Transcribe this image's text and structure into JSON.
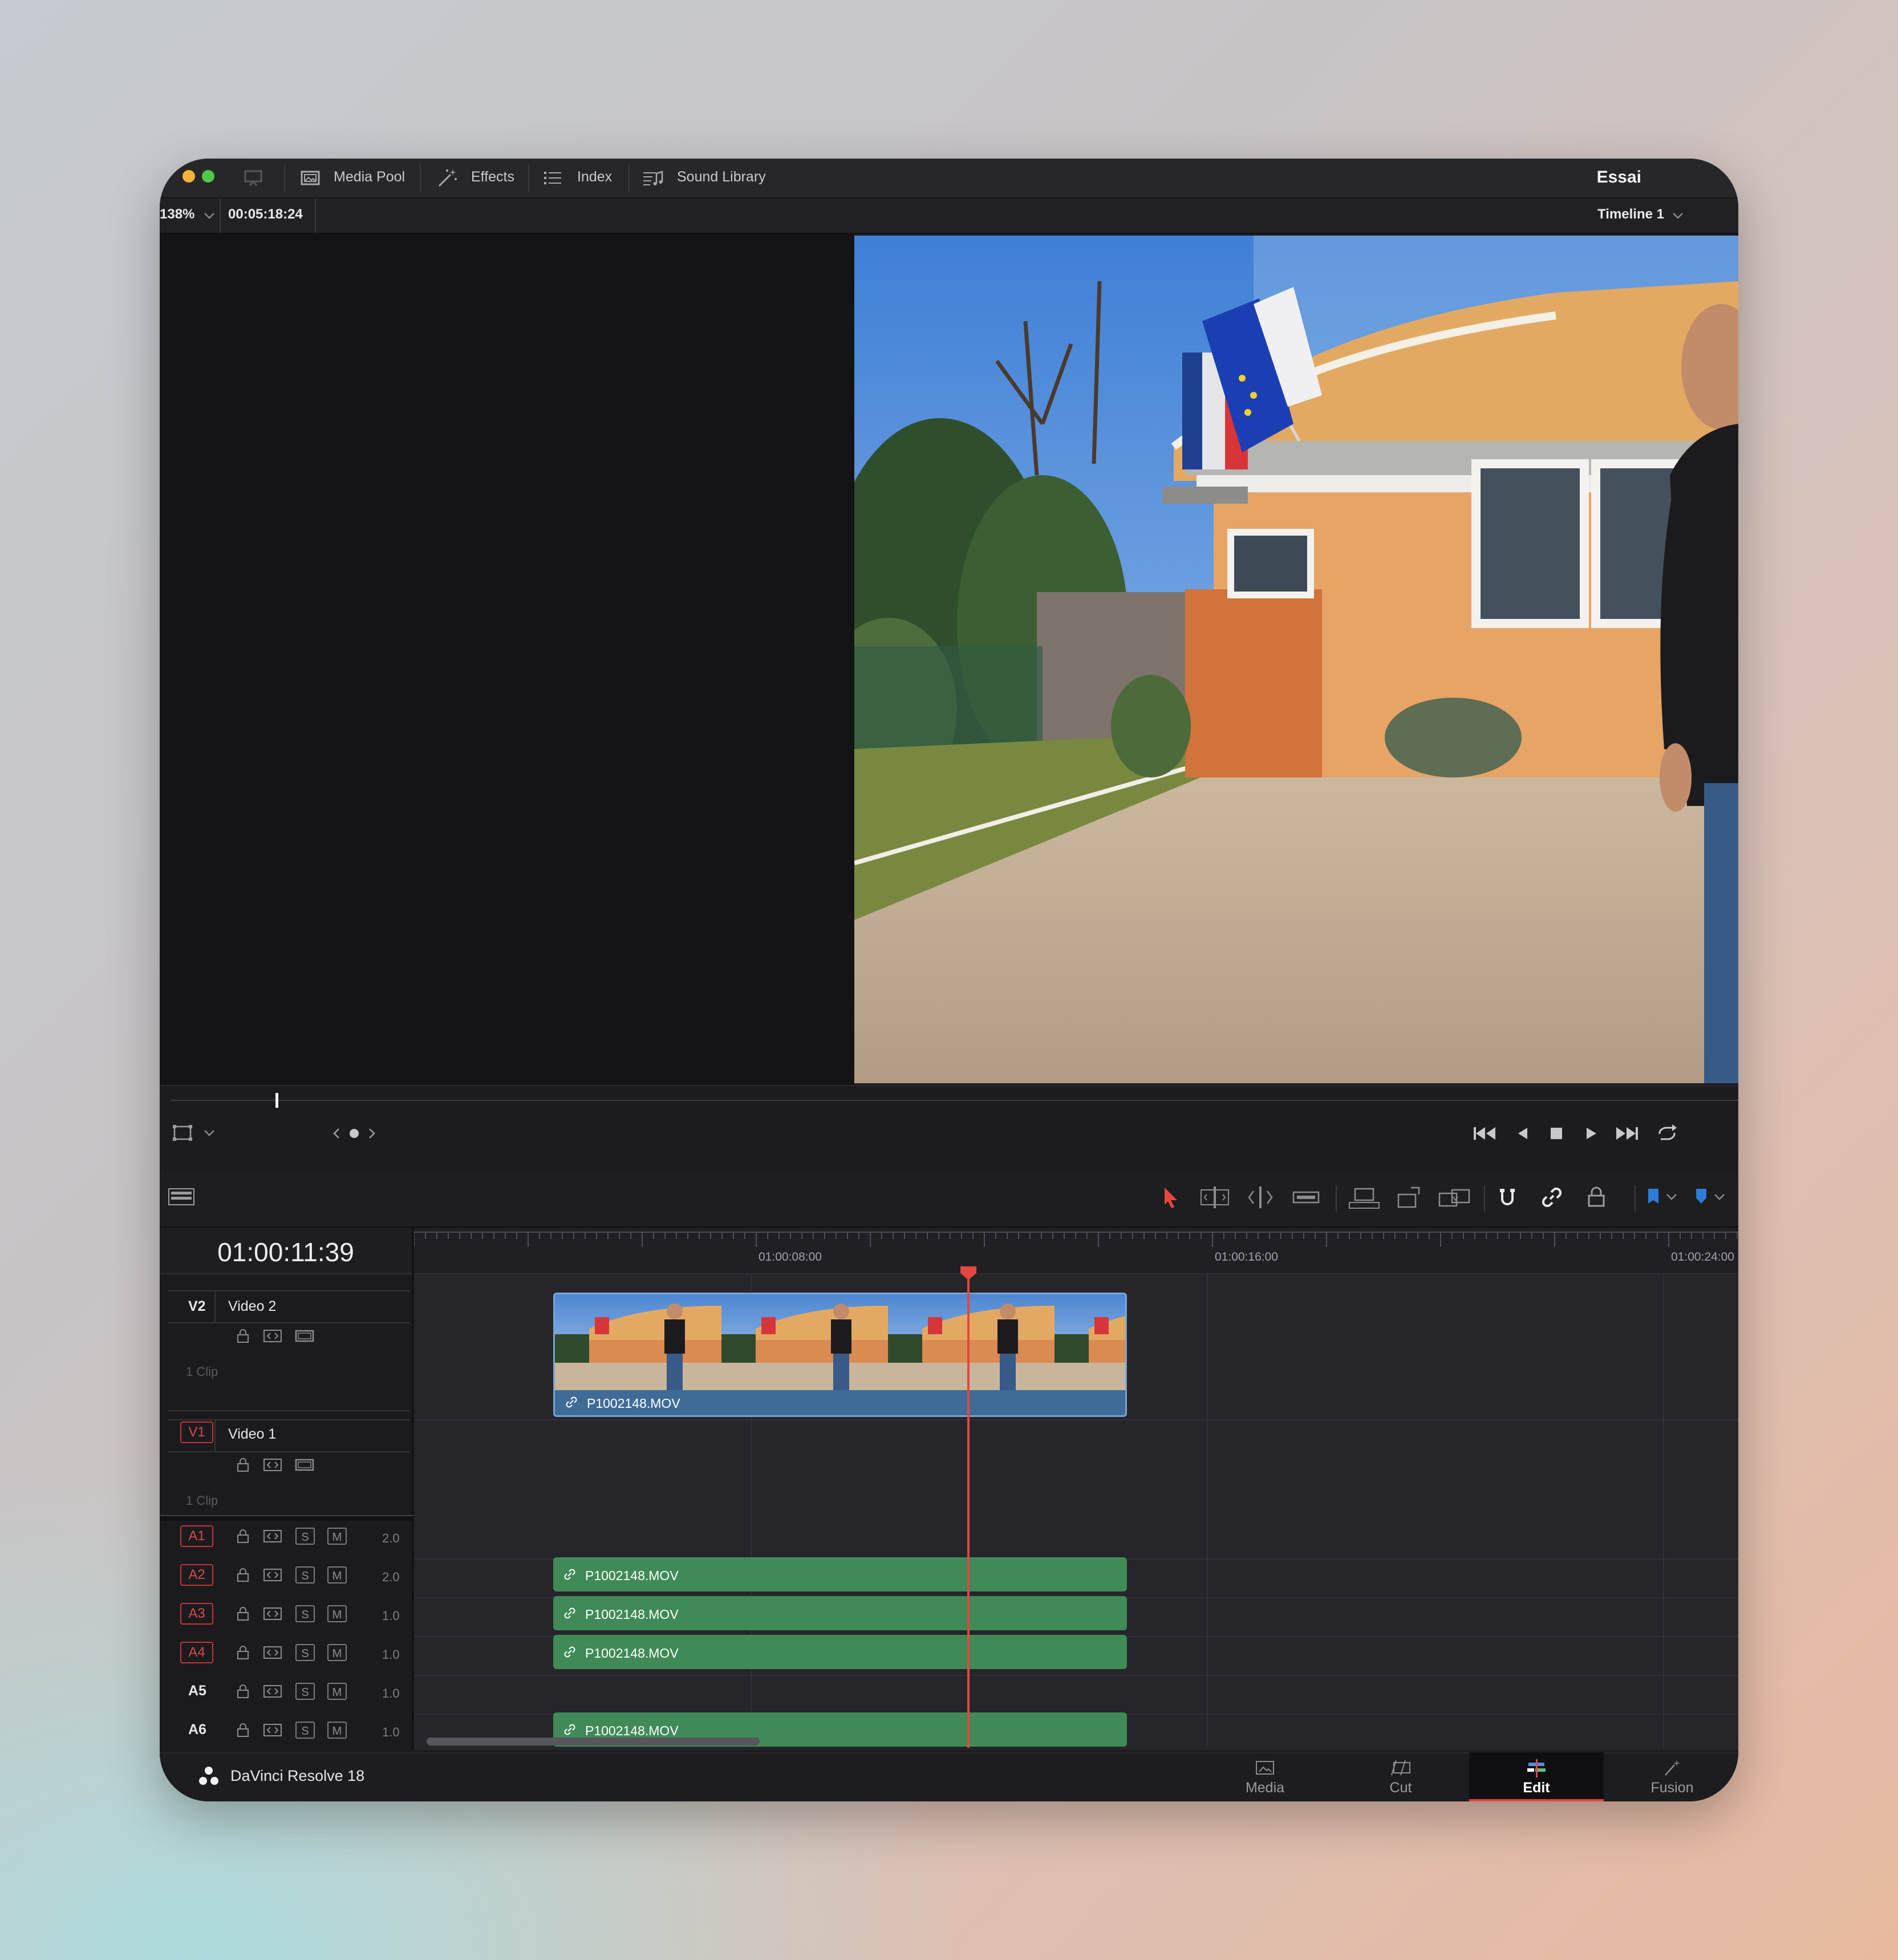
{
  "app": {
    "name": "DaVinci Resolve 18",
    "project_title": "Essai"
  },
  "toolbar": {
    "media_pool": "Media Pool",
    "effects": "Effects",
    "index": "Index",
    "sound_library": "Sound Library"
  },
  "viewer": {
    "zoom": "138%",
    "timecode": "00:05:18:24",
    "timeline_name": "Timeline 1"
  },
  "timeline": {
    "current_timecode": "01:00:11:39",
    "ruler_labels": [
      "01:00:08:00",
      "01:00:16:00",
      "01:00:24:00"
    ],
    "video_tracks": [
      {
        "id": "V2",
        "name": "Video 2",
        "clips_label": "1 Clip"
      },
      {
        "id": "V1",
        "name": "Video 1",
        "clips_label": "1 Clip"
      }
    ],
    "audio_tracks": [
      {
        "id": "A1",
        "channels": "2.0"
      },
      {
        "id": "A2",
        "channels": "2.0"
      },
      {
        "id": "A3",
        "channels": "1.0"
      },
      {
        "id": "A4",
        "channels": "1.0"
      },
      {
        "id": "A5",
        "channels": "1.0"
      },
      {
        "id": "A6",
        "channels": "1.0"
      }
    ],
    "video_clip": {
      "name": "P1002148.MOV"
    },
    "audio_clips": [
      "P1002148.MOV",
      "P1002148.MOV",
      "P1002148.MOV",
      "P1002148.MOV"
    ],
    "solo_label": "S",
    "mute_label": "M"
  },
  "pages": [
    "Media",
    "Cut",
    "Edit",
    "Fusion"
  ],
  "active_page": "Edit",
  "colors": {
    "playhead": "#e5463f",
    "video_clip": "#3f6b98",
    "audio_clip": "#3f8a57",
    "track_armed": "#c2343a",
    "window_bg": "#1c1c1e"
  },
  "icons": [
    "display-icon",
    "media-pool-icon",
    "effects-wand-icon",
    "index-list-icon",
    "sound-library-icon",
    "chevron-down-icon",
    "crop-icon",
    "go-to-start-icon",
    "step-back-icon",
    "stop-icon",
    "play-icon",
    "go-to-end-icon",
    "loop-icon",
    "timeline-layout-icon",
    "selection-arrow-icon",
    "trim-icon",
    "dynamic-trim-icon",
    "blade-icon",
    "insert-clip-icon",
    "overwrite-clip-icon",
    "replace-clip-icon",
    "snapping-icon",
    "linked-selection-icon",
    "position-lock-icon",
    "flag-icon",
    "marker-icon",
    "lock-icon",
    "auto-track-icon",
    "track-video-icon",
    "link-icon",
    "davinci-logo-icon"
  ]
}
